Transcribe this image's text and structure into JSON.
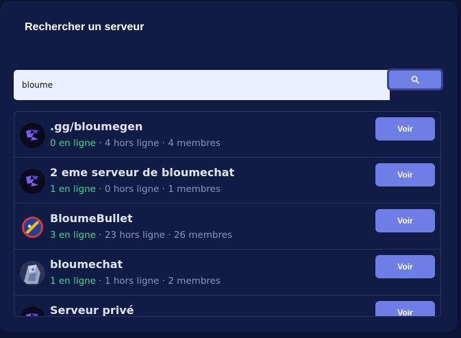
{
  "panel": {
    "title": "Rechercher un serveur"
  },
  "search": {
    "value": "bloume",
    "button_icon": "search-icon"
  },
  "servers": [
    {
      "name": ".gg/bloumegen",
      "online": "0 en ligne",
      "offline": "4 hors ligne",
      "members": "4 membres",
      "avatar": "purple-hexagon-logo",
      "button_label": "Voir"
    },
    {
      "name": "2 eme serveur de bloumechat",
      "online": "1 en ligne",
      "offline": "0 hors ligne",
      "members": "1 membres",
      "avatar": "purple-hexagon-logo",
      "button_label": "Voir"
    },
    {
      "name": "BloumeBullet",
      "online": "3 en ligne",
      "offline": "23 hors ligne",
      "members": "26 membres",
      "avatar": "bullet-logo",
      "button_label": "Voir"
    },
    {
      "name": "bloumechat",
      "online": "1 en ligne",
      "offline": "1 hors ligne",
      "members": "2 membres",
      "avatar": "robot-avatar",
      "button_label": "Voir"
    },
    {
      "name": "Serveur privé",
      "online": "",
      "offline": "",
      "members": "",
      "avatar": "purple-hexagon-logo",
      "button_label": "Voir"
    }
  ],
  "separator": " · ",
  "colors": {
    "online": "#3dd68c",
    "accent": "#6f7ee6",
    "panel": "#111c45"
  }
}
